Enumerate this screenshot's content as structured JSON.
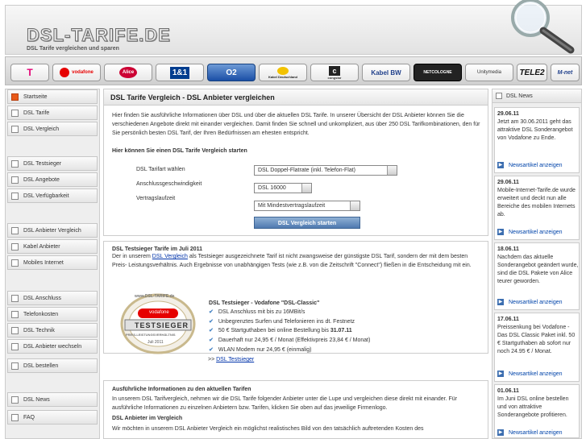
{
  "header": {
    "logo": "DSL-TARIFE.DE",
    "tagline": "DSL Tarife vergleichen und sparen"
  },
  "providers": [
    {
      "name": "T",
      "color": "#e20074"
    },
    {
      "name": "vodafone",
      "color": "#e60000"
    },
    {
      "name": "Alice",
      "color": "#cc0033"
    },
    {
      "name": "1&1",
      "color": "#003d8f"
    },
    {
      "name": "O2",
      "color": "#1b4fa6"
    },
    {
      "name": "Kabel Deutschland",
      "color": "#222222"
    },
    {
      "name": "congstar",
      "color": "#222222"
    },
    {
      "name": "Kabel BW",
      "color": "#1f3f8a"
    },
    {
      "name": "NETCOLOGNE",
      "color": "#222222"
    },
    {
      "name": "Unitymedia",
      "color": "#333333"
    },
    {
      "name": "TELE2",
      "color": "#111111"
    },
    {
      "name": "M-net",
      "color": "#1f3f8a"
    }
  ],
  "nav": {
    "groups": [
      {
        "items": [
          {
            "label": "Startseite",
            "active": true
          }
        ]
      },
      {
        "items": [
          {
            "label": "DSL Tarife"
          },
          {
            "label": "DSL Vergleich"
          }
        ]
      },
      {
        "items": [
          {
            "label": "DSL Testsieger"
          },
          {
            "label": "DSL Angebote"
          },
          {
            "label": "DSL Verfügbarkeit"
          }
        ]
      },
      {
        "items": [
          {
            "label": "DSL Anbieter Vergleich"
          },
          {
            "label": "Kabel Anbieter"
          },
          {
            "label": "Mobiles Internet"
          }
        ]
      },
      {
        "items": [
          {
            "label": "DSL Anschluss"
          },
          {
            "label": "Telefonkosten"
          },
          {
            "label": "DSL Technik"
          },
          {
            "label": "DSL Anbieter wechseln"
          },
          {
            "label": "DSL bestellen"
          }
        ]
      },
      {
        "items": [
          {
            "label": "DSL News"
          },
          {
            "label": "FAQ"
          }
        ]
      }
    ]
  },
  "compare": {
    "title": "DSL Tarife Vergleich - DSL Anbieter vergleichen",
    "intro": "Hier finden Sie ausführliche Informationen über DSL und über die aktuellen DSL Tarife. In unserer Übersicht der DSL Anbieter können Sie die verschiedenen Angebote direkt mit einander vergleichen. Damit finden Sie schnell und unkompliziert, aus über 250 DSL Tarifkombinationen, den für Sie persönlich besten DSL Tarif, der Ihren Bedürfnissen am ehesten entspricht.",
    "subhead": "Hier können Sie einen DSL Tarife Vergleich starten",
    "tarif_label": "DSL Tarifart wählen",
    "tarif_value": "DSL Doppel-Flatrate (inkl. Telefon-Flat)",
    "speed_label": "Anschlussgeschwindigkeit",
    "speed_value": "DSL 16000",
    "term_label": "Vertragslaufzeit",
    "term_value": "Mit Mindestvertragslaufzeit",
    "button": "DSL Vergleich starten"
  },
  "testsieger": {
    "title": "DSL Testsieger Tarife im Juli 2011",
    "text_pre": "Der in unserem ",
    "text_link": "DSL Vergleich",
    "text_post": " als Testsieger ausgezeichnete Tarif ist nicht zwangsweise der günstigste DSL Tarif, sondern der mit dem besten Preis- Leistungsverhältnis. Auch Ergebnisse von unabhängigen Tests (wie z.B. von die Zeitschrift \"Connect\") fließen in die Entscheidung mit ein.",
    "seal_top": "www.DSL-TARIFE.de",
    "seal_brand": "vodafone",
    "seal_main": "TESTSIEGER",
    "seal_bottom": "PREIS-LEISTUNGSVERHÄLTNIS",
    "seal_date": "Juli 2011",
    "offer_title": "DSL Testsieger - Vodafone \"DSL-Classic\"",
    "features": [
      "DSL Anschluss mit bis zu 16MBit/s",
      "Unbegrenztes Surfen und Telefonieren ins dt. Festnetz",
      "50 € Startguthaben bei online Bestellung bis ",
      "Dauerhaft nur 24,95 € / Monat (Effektivpreis 23,84 € / Monat)",
      "WLAN Modem nur 24,95 € (einmalig)"
    ],
    "deadline": "31.07.11",
    "link_prefix": ">> ",
    "link": "DSL Testsieger"
  },
  "info": {
    "title": "Ausführliche Informationen zu den aktuellen Tarifen",
    "text": "In unserem DSL Tarifvergleich, nehmen wir die DSL Tarife folgender Anbieter unter die Lupe und vergleichen diese direkt mit einander. Für ausführliche Informationen zu einzelnen Anbietern bzw. Tarifen, klicken Sie oben auf das jeweilige Firmenlogo.",
    "subhead": "DSL Anbieter im Vergleich",
    "text2": "Wir möchten in unserem DSL Anbieter Vergleich ein möglichst realistisches Bild von den tatsächlich auftretenden Kosten des"
  },
  "news": {
    "title": "DSL News",
    "more": "Newsartikel anzeigen",
    "items": [
      {
        "date": "29.06.11",
        "text": "Jetzt am 30.06.2011 geht das attraktive DSL Sonderangebot von Vodafone zu Ende."
      },
      {
        "date": "29.06.11",
        "text": "Mobile-Internet-Tarife.de wurde erweitert und deckt nun alle Bereiche des mobilen Internets ab."
      },
      {
        "date": "18.06.11",
        "text": "Nachdem das aktuelle Sonderangebot geändert wurde, sind die DSL Pakete von Alice teurer geworden."
      },
      {
        "date": "17.06.11",
        "text": "Preissenkung bei Vodafone - Das DSL Classic Paket inkl. 50 € Startguthaben ab sofort nur noch 24.95 € / Monat."
      },
      {
        "date": "01.06.11",
        "text": "Im Juni DSL online bestellen und von attraktive Sonderangebote profitieren."
      }
    ]
  }
}
